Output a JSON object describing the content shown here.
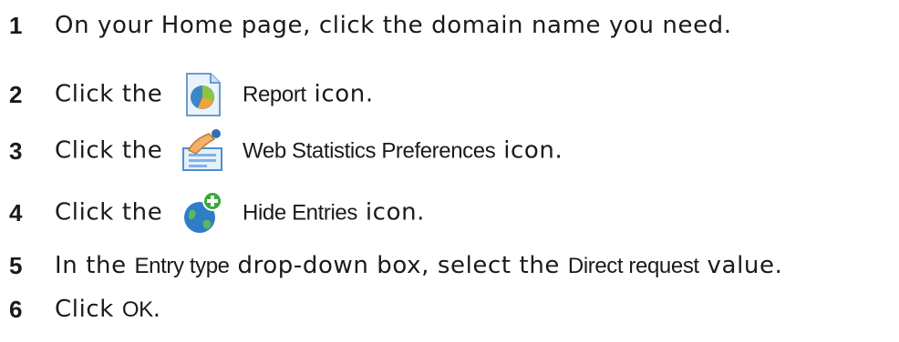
{
  "steps": [
    {
      "number": "1",
      "text": "On your Home page, click the domain name you need."
    },
    {
      "number": "2",
      "before": "Click the",
      "icon": "report-icon",
      "label": "Report",
      "after": " icon."
    },
    {
      "number": "3",
      "before": "Click the",
      "icon": "web-statistics-preferences-icon",
      "label": "Web Statistics Preferences",
      "after": " icon."
    },
    {
      "number": "4",
      "before": "Click the",
      "icon": "hide-entries-icon",
      "label": "Hide Entries",
      "after": " icon."
    },
    {
      "number": "5",
      "before": "In the ",
      "label1": "Entry type",
      "middle": " drop-down box, select the ",
      "label2": "Direct request",
      "after": " value."
    },
    {
      "number": "6",
      "before": "Click ",
      "label": "OK",
      "after": "."
    }
  ]
}
